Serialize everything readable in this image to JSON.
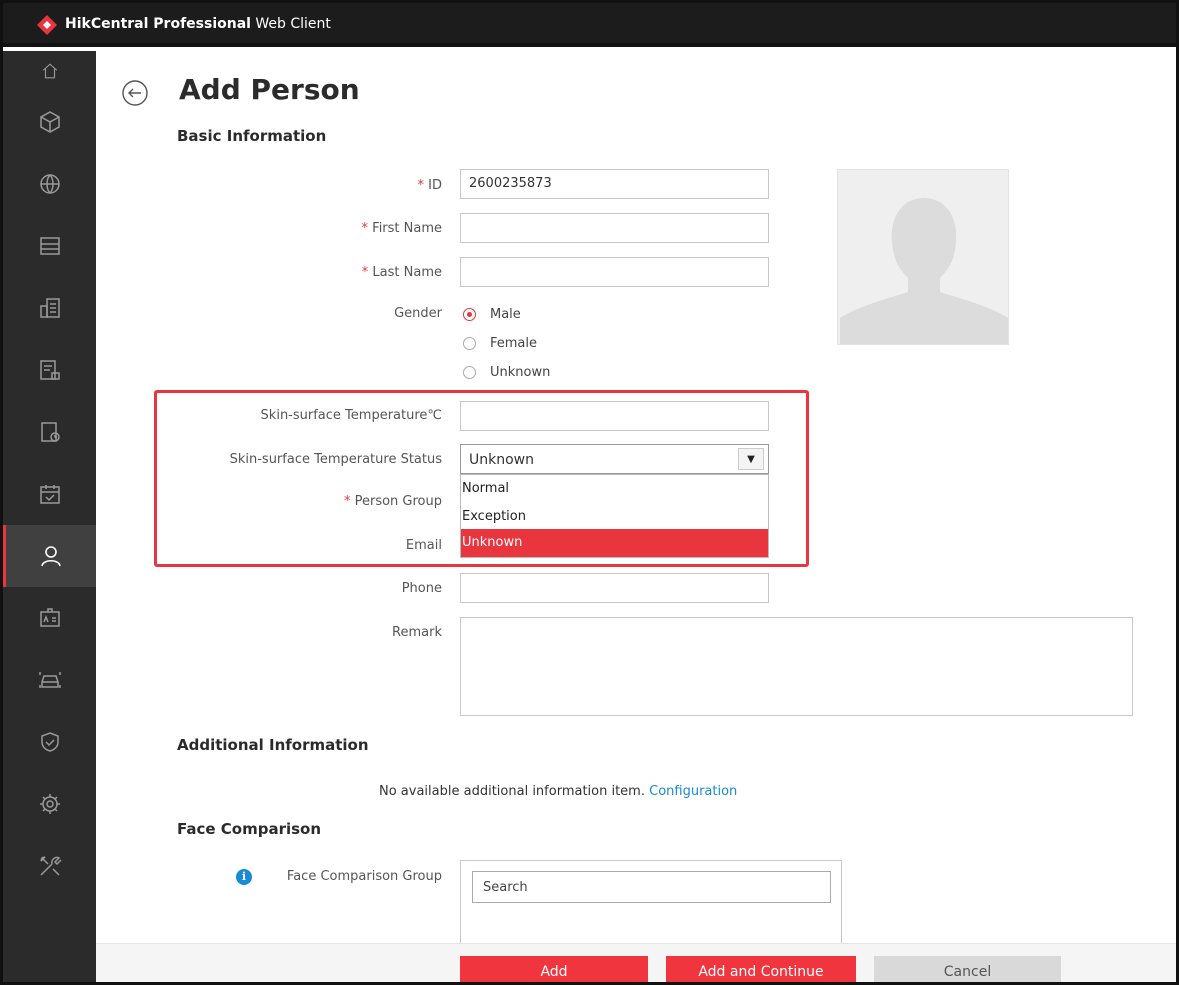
{
  "app": {
    "brand_bold": "HikCentral Professional",
    "brand_rest": " Web Client"
  },
  "page": {
    "title": "Add Person"
  },
  "sections": {
    "basic": "Basic Information",
    "additional": "Additional Information",
    "face": "Face Comparison"
  },
  "fields": {
    "id": {
      "label": "ID",
      "required_mark": "*",
      "value": "2600235873"
    },
    "first_name": {
      "label": "First Name",
      "required_mark": "*",
      "value": ""
    },
    "last_name": {
      "label": "Last Name",
      "required_mark": "*",
      "value": ""
    },
    "gender": {
      "label": "Gender",
      "options": [
        "Male",
        "Female",
        "Unknown"
      ],
      "selected": "Male"
    },
    "temperature": {
      "label": "Skin-surface Temperature℃",
      "value": ""
    },
    "temp_status": {
      "label": "Skin-surface Temperature Status",
      "value": "Unknown",
      "options": [
        "Normal",
        "Exception",
        "Unknown"
      ],
      "highlighted": "Unknown"
    },
    "person_group": {
      "label": "Person Group",
      "required_mark": "*"
    },
    "email": {
      "label": "Email"
    },
    "phone": {
      "label": "Phone",
      "value": ""
    },
    "remark": {
      "label": "Remark",
      "value": ""
    }
  },
  "additional": {
    "message": "No available additional information item. ",
    "link": "Configuration"
  },
  "face": {
    "group_label": "Face Comparison Group",
    "search_placeholder": "Search"
  },
  "buttons": {
    "add": "Add",
    "add_continue": "Add and Continue",
    "cancel": "Cancel"
  },
  "sidebar": {
    "items": [
      "home-icon",
      "cube-icon",
      "globe-icon",
      "storage-icon",
      "building-icon",
      "document-lock-icon",
      "tablet-clock-icon",
      "calendar-check-icon",
      "person-icon",
      "id-card-icon",
      "vehicle-icon",
      "shield-icon",
      "gear-icon",
      "tools-icon"
    ],
    "active": "person-icon"
  },
  "colors": {
    "accent": "#e8353e",
    "link": "#1a8ad6",
    "sidebar": "#2b2b2b",
    "topbar": "#1c1c1c"
  }
}
